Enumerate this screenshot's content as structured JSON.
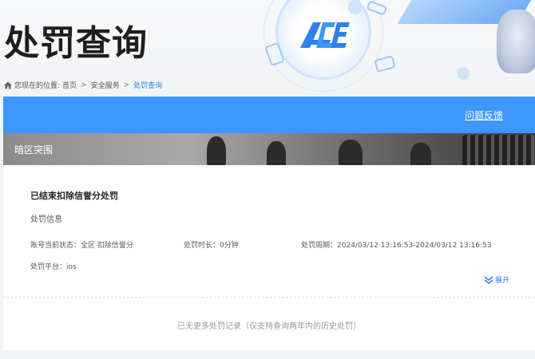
{
  "header": {
    "title": "处罚查询",
    "logo_text": "ACE"
  },
  "breadcrumb": {
    "prefix": "您现在的位置:",
    "items": [
      "首页",
      "安全服务",
      "处罚查询"
    ],
    "separator": ">"
  },
  "toolbar": {
    "feedback_label": "问题反馈"
  },
  "banner": {
    "label": "暗区突围"
  },
  "record": {
    "title": "已结束扣除信誉分处罚",
    "section_label": "处罚信息",
    "account_status_label": "账号当前状态：",
    "account_status_value": "全区 扣除信誉分",
    "duration_label": "处罚时长：",
    "duration_value": "0分钟",
    "period_label": "处罚周期：",
    "period_value": "2024/03/12 13:16:53-2024/03/12 13:16:53",
    "platform_label": "处罚平台：",
    "platform_value": "ios",
    "expand_label": "展开"
  },
  "footer": {
    "no_more_text": "已无更多处罚记录（仅支持查询两年内的历史处罚）"
  },
  "colors": {
    "accent": "#3c98fb",
    "link": "#2f80ed"
  },
  "icons": {
    "home": "home-icon",
    "expand": "double-chevron-down-icon"
  }
}
